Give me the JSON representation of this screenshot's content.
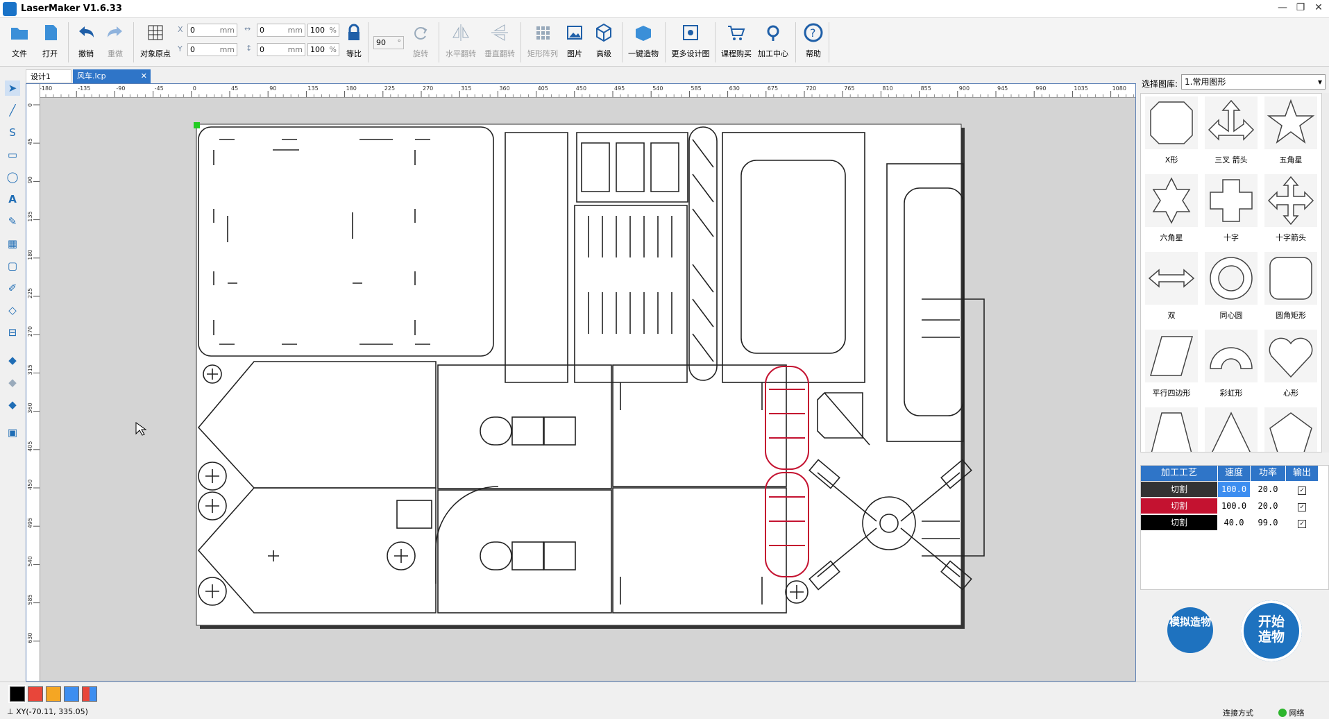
{
  "app": {
    "title": "LaserMaker V1.6.33"
  },
  "toolbar": {
    "file": "文件",
    "open": "打开",
    "undo": "撤销",
    "redo": "重做",
    "origin": "对象原点",
    "x_label": "X",
    "y_label": "Y",
    "x_value": "0",
    "y_value": "0",
    "w_value": "0",
    "h_value": "0",
    "unit": "mm",
    "w_pct": "100",
    "h_pct": "100",
    "pct": "%",
    "lock": "等比",
    "angle": "90",
    "angle_unit": "°",
    "rotate": "旋转",
    "hflip": "水平翻转",
    "vflip": "垂直翻转",
    "array": "矩形阵列",
    "image": "图片",
    "advanced": "高级",
    "oneclick": "一键造物",
    "more_designs": "更多设计图",
    "courses": "课程购买",
    "process_center": "加工中心",
    "help": "帮助"
  },
  "tabs": [
    {
      "label": "设计1"
    },
    {
      "label": "风车.lcp"
    }
  ],
  "ruler": {
    "top_ticks": [
      "-180",
      "-135",
      "-90",
      "-45",
      "0",
      "45",
      "90",
      "135",
      "180",
      "225",
      "270",
      "315",
      "360",
      "405",
      "450",
      "495",
      "540",
      "585",
      "630",
      "675",
      "720",
      "765",
      "810",
      "855",
      "900",
      "945",
      "990",
      "1035",
      "1080"
    ],
    "left_ticks": [
      "0",
      "45",
      "90",
      "135",
      "180",
      "225",
      "270",
      "315",
      "360",
      "405",
      "450",
      "495",
      "540",
      "585",
      "630"
    ]
  },
  "library": {
    "label": "选择图库:",
    "selected": "1.常用图形",
    "shapes": [
      "X形",
      "三叉 箭头",
      "五角星",
      "六角星",
      "十字",
      "十字箭头",
      "双",
      "同心圆",
      "圆角矩形",
      "平行四边形",
      "彩虹形",
      "心形",
      "",
      "",
      ""
    ]
  },
  "layers": {
    "headers": [
      "加工工艺",
      "速度",
      "功率",
      "输出"
    ],
    "rows": [
      {
        "mode": "切割",
        "speed": "100.0",
        "power": "20.0",
        "color": "#333333"
      },
      {
        "mode": "切割",
        "speed": "100.0",
        "power": "20.0",
        "color": "#c41230"
      },
      {
        "mode": "切割",
        "speed": "40.0",
        "power": "99.0",
        "color": "#000000"
      }
    ]
  },
  "actions": {
    "simulate": "模拟造物",
    "start": "开始造物"
  },
  "palette": [
    "#000000",
    "#e8463a",
    "#f5a623",
    "#3d8ef0",
    "multi"
  ],
  "status": {
    "xy": "XY(-70.11, 335.05)",
    "connect": "连接方式",
    "network": "网络",
    "network_color": "#2db52d"
  }
}
